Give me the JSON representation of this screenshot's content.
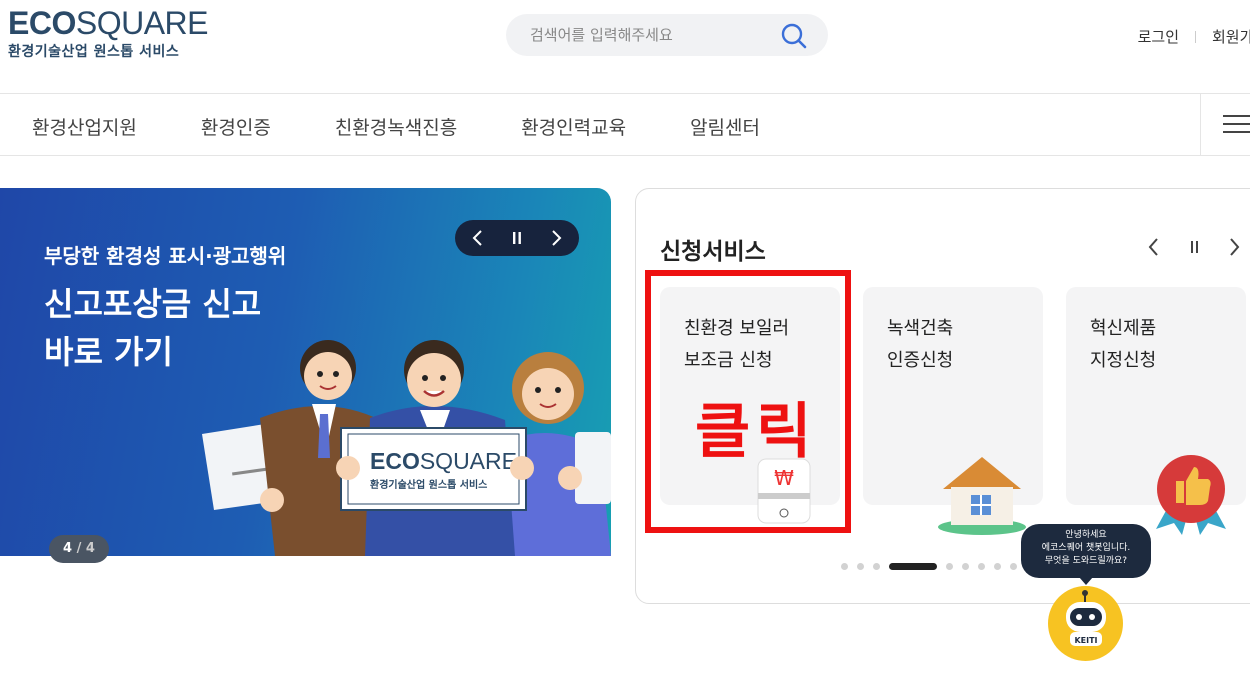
{
  "header": {
    "logo_bold": "ECO",
    "logo_thin": "SQUARE",
    "logo_sub": "환경기술산업 원스톱 서비스",
    "search_placeholder": "검색어를 입력해주세요",
    "login": "로그인",
    "join": "회원가입"
  },
  "gnb": [
    "환경산업지원",
    "환경인증",
    "친환경녹색진흥",
    "환경인력교육",
    "알림센터"
  ],
  "banner": {
    "subtitle": "부당한 환경성 표시·광고행위",
    "title_line1": "신고포상금 신고",
    "title_line2": "바로 가기",
    "placard_bold": "ECO",
    "placard_thin": "SQUARE",
    "placard_sub": "환경기술산업 원스톱 서비스",
    "page_current": "4",
    "page_total": "/ 4"
  },
  "service": {
    "title": "신청서비스",
    "cards": [
      {
        "line1": "친환경 보일러",
        "line2": "보조금 신청"
      },
      {
        "line1": "녹색건축",
        "line2": "인증신청"
      },
      {
        "line1": "혁신제품",
        "line2": "지정신청"
      }
    ],
    "annotation": "클릭",
    "dots_count": 14,
    "active_dot": 3
  },
  "chatbot": {
    "line1": "안녕하세요",
    "line2": "에코스퀘어 챗봇입니다.",
    "line3": "무엇을 도와드릴까요?",
    "bot_label": "KEITI"
  },
  "colors": {
    "brand_navy": "#2b4a68",
    "banner_start": "#1f47a8",
    "banner_end": "#17a0b2",
    "annotation_red": "#ee1111",
    "bot_yellow": "#f7c322"
  }
}
